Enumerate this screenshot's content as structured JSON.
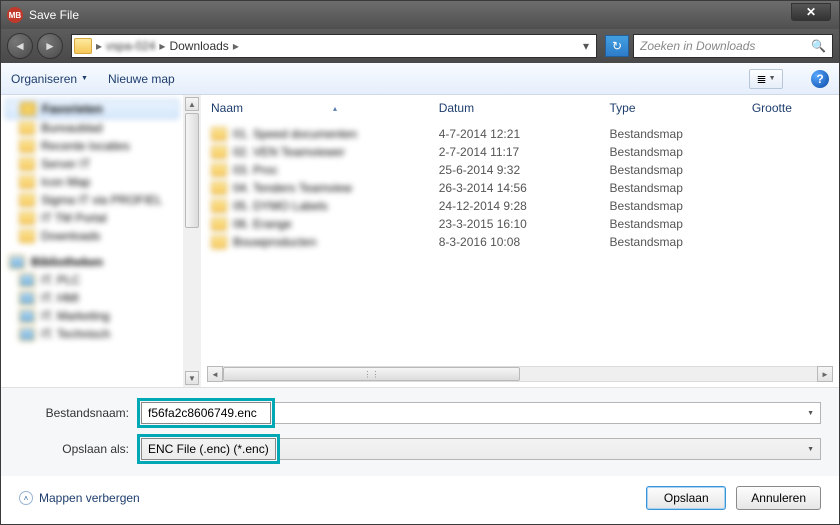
{
  "window": {
    "title": "Save File"
  },
  "nav": {
    "crumb1": "vspa-024",
    "crumb2": "Downloads",
    "search_placeholder": "Zoeken in Downloads"
  },
  "toolbar": {
    "organize": "Organiseren",
    "newfolder": "Nieuwe map"
  },
  "columns": {
    "name": "Naam",
    "date": "Datum",
    "type": "Type",
    "size": "Grootte"
  },
  "rows": [
    {
      "name": "01. Speed documenten",
      "date": "4-7-2014 12:21",
      "type": "Bestandsmap"
    },
    {
      "name": "02. VEN Teamviewer",
      "date": "2-7-2014 11:17",
      "type": "Bestandsmap"
    },
    {
      "name": "03. Proc",
      "date": "25-6-2014 9:32",
      "type": "Bestandsmap"
    },
    {
      "name": "04. Tenders Teamview",
      "date": "26-3-2014 14:56",
      "type": "Bestandsmap"
    },
    {
      "name": "05. DYMO Labels",
      "date": "24-12-2014 9:28",
      "type": "Bestandsmap"
    },
    {
      "name": "06. Erange",
      "date": "23-3-2015 16:10",
      "type": "Bestandsmap"
    },
    {
      "name": "Bouwproducten",
      "date": "8-3-2016 10:08",
      "type": "Bestandsmap"
    }
  ],
  "sidebar": {
    "group1": "Favorieten",
    "g1items": [
      "Bureaublad",
      "Recente locaties",
      "Server IT",
      "Icon Map",
      "Sigma IT via PROFIEL",
      "IT TM Portal",
      "Downloads"
    ],
    "group2": "Bibliotheken",
    "g2items": [
      "IT. PLC",
      "IT. HMI",
      "IT. Marketing",
      "IT. Technisch"
    ]
  },
  "fields": {
    "filename_label": "Bestandsnaam:",
    "filename_value": "f56fa2c8606749.enc",
    "saveas_label": "Opslaan als:",
    "saveas_value": "ENC File (.enc) (*.enc)"
  },
  "footer": {
    "hidefolders": "Mappen verbergen",
    "save": "Opslaan",
    "cancel": "Annuleren"
  }
}
